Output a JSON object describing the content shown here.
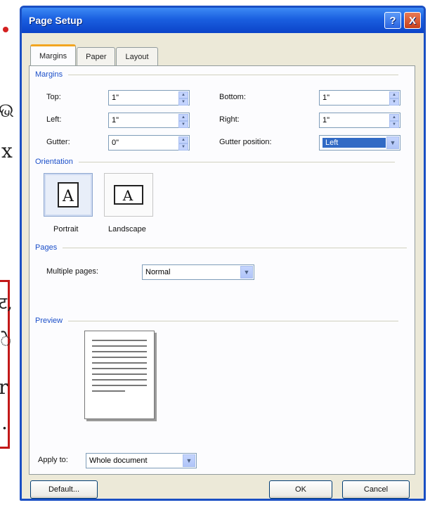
{
  "background": {
    "glyphs": [
      "ଭ",
      "x",
      "ट,",
      "े",
      "r",
      "."
    ]
  },
  "dialog": {
    "title": "Page Setup",
    "help_button": "?",
    "close_button": "X",
    "tabs": [
      {
        "label": "Margins",
        "active": true
      },
      {
        "label": "Paper",
        "active": false
      },
      {
        "label": "Layout",
        "active": false
      }
    ],
    "margins": {
      "heading": "Margins",
      "top_label": "Top:",
      "top_value": "1\"",
      "bottom_label": "Bottom:",
      "bottom_value": "1\"",
      "left_label": "Left:",
      "left_value": "1\"",
      "right_label": "Right:",
      "right_value": "1\"",
      "gutter_label": "Gutter:",
      "gutter_value": "0\"",
      "gutter_position_label": "Gutter position:",
      "gutter_position_value": "Left"
    },
    "orientation": {
      "heading": "Orientation",
      "portrait_label": "Portrait",
      "landscape_label": "Landscape",
      "selected": "Portrait"
    },
    "pages": {
      "heading": "Pages",
      "multiple_pages_label": "Multiple pages:",
      "multiple_pages_value": "Normal"
    },
    "preview": {
      "heading": "Preview",
      "apply_to_label": "Apply to:",
      "apply_to_value": "Whole document"
    },
    "buttons": {
      "default_label": "Default...",
      "ok_label": "OK",
      "cancel_label": "Cancel"
    },
    "colors": {
      "title_bar": "#1a5fe0",
      "section_heading": "#1b4fc9",
      "selection": "#316ac5",
      "highlight_box": "#c21818"
    }
  }
}
